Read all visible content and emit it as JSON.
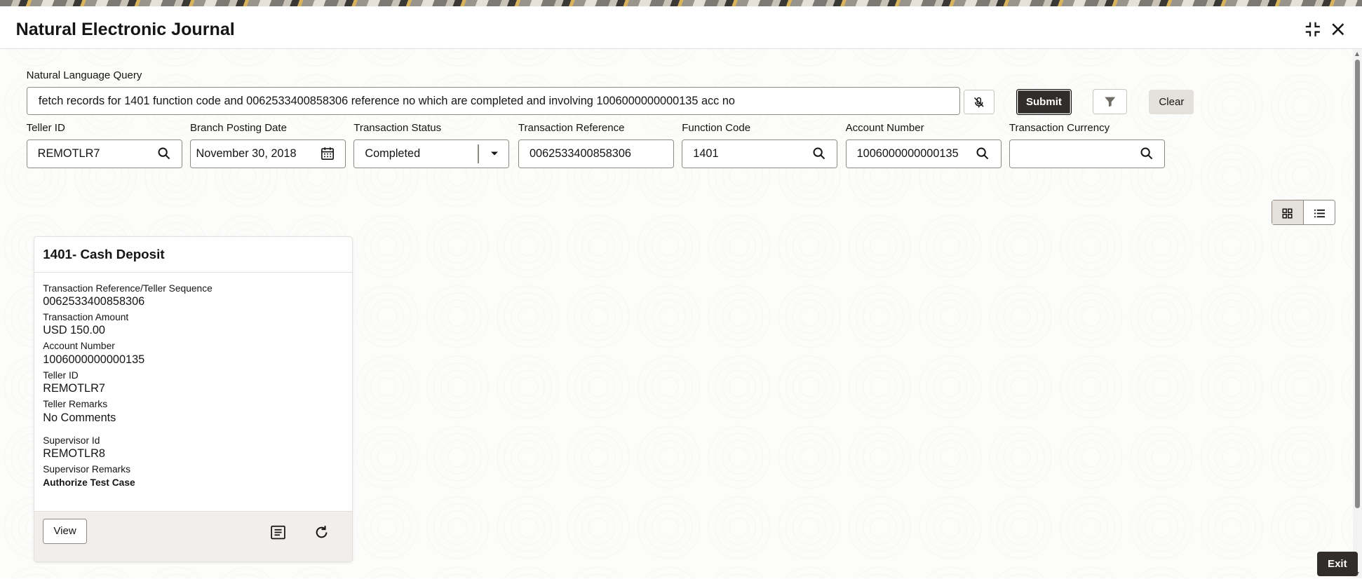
{
  "window": {
    "title": "Natural Electronic Journal"
  },
  "query": {
    "label": "Natural Language Query",
    "value": "fetch records for 1401 function code and 0062533400858306 reference no which are completed and involving 1006000000000135 acc no",
    "submit_label": "Submit",
    "clear_label": "Clear"
  },
  "filters": {
    "teller_id": {
      "label": "Teller ID",
      "value": "REMOTLR7"
    },
    "branch_posting_date": {
      "label": "Branch Posting Date",
      "value": "November 30, 2018"
    },
    "transaction_status": {
      "label": "Transaction Status",
      "value": "Completed"
    },
    "transaction_reference": {
      "label": "Transaction Reference",
      "value": "0062533400858306"
    },
    "function_code": {
      "label": "Function Code",
      "value": "1401"
    },
    "account_number": {
      "label": "Account Number",
      "value": "1006000000000135"
    },
    "transaction_currency": {
      "label": "Transaction Currency",
      "value": ""
    }
  },
  "view_toggle": {
    "active": "grid"
  },
  "card": {
    "title": "1401- Cash Deposit",
    "fields": [
      {
        "label": "Transaction Reference/Teller Sequence",
        "value": "0062533400858306"
      },
      {
        "label": "Transaction Amount",
        "value": "USD 150.00"
      },
      {
        "label": "Account Number",
        "value": "1006000000000135"
      },
      {
        "label": "Teller ID",
        "value": "REMOTLR7"
      },
      {
        "label": "Teller Remarks",
        "value": "No Comments"
      },
      {
        "label": "Supervisor Id",
        "value": "REMOTLR8"
      },
      {
        "label": "Supervisor Remarks",
        "value": "Authorize Test Case"
      }
    ],
    "view_label": "View"
  },
  "footer": {
    "exit_label": "Exit"
  },
  "icons": {
    "minimize": "collapse-icon",
    "close": "close-icon",
    "mic": "mic-off-icon",
    "filter": "filter-icon",
    "search": "search-icon",
    "calendar": "calendar-icon",
    "grid": "grid-view-icon",
    "list": "list-view-icon",
    "journal": "journal-icon",
    "refresh": "refresh-icon"
  },
  "colors": {
    "primary_button": "#312d2a",
    "border": "#8e8a83",
    "clear_button": "#e4e1dc"
  }
}
